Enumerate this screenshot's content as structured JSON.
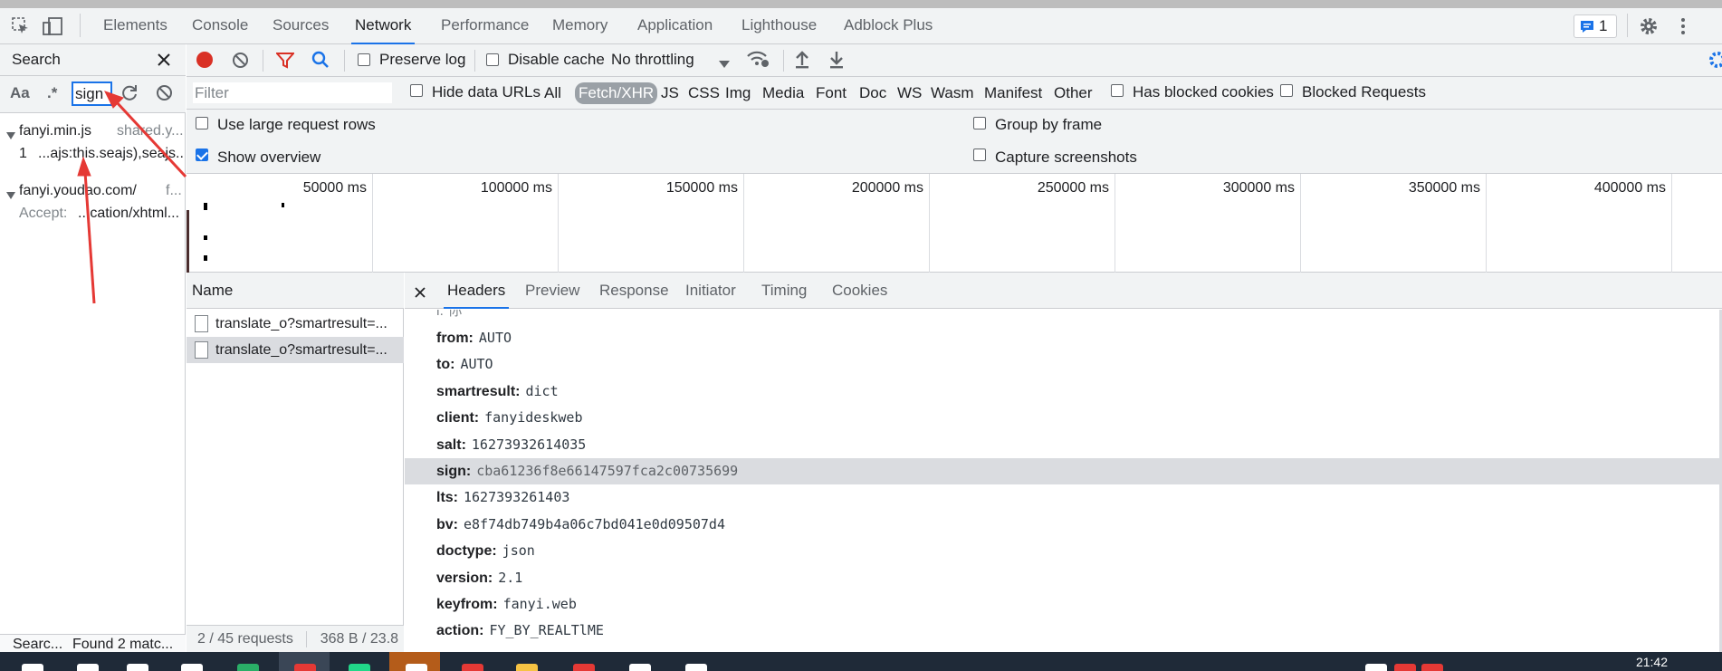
{
  "main_tabs": [
    "Elements",
    "Console",
    "Sources",
    "Network",
    "Performance",
    "Memory",
    "Application",
    "Lighthouse",
    "Adblock Plus"
  ],
  "active_tab": "Network",
  "issues_badge": "1",
  "search_pane": {
    "title": "Search",
    "case_toggle": "Aa",
    "regex_toggle": ".*",
    "query": "sign",
    "results": [
      {
        "file": "fanyi.min.js",
        "origin": "shared.y...",
        "line_no": "1",
        "snippet": "...ajs:this.seajs),seajs...."
      },
      {
        "file": "fanyi.youdao.com/",
        "origin": "f...",
        "line_label": "Accept:",
        "snippet": "...cation/xhtml..."
      }
    ],
    "status_left": "Searc...",
    "status_right": "Found 2 matc..."
  },
  "toolbar": {
    "preserve_log": "Preserve log",
    "disable_cache": "Disable cache",
    "throttling": "No throttling"
  },
  "filter_bar": {
    "placeholder": "Filter",
    "hide_data_urls": "Hide data URLs",
    "types": [
      "All",
      "Fetch/XHR",
      "JS",
      "CSS",
      "Img",
      "Media",
      "Font",
      "Doc",
      "WS",
      "Wasm",
      "Manifest",
      "Other"
    ],
    "active_type": "Fetch/XHR",
    "has_blocked_cookies": "Has blocked cookies",
    "blocked_requests": "Blocked Requests"
  },
  "settings": {
    "use_large_rows": "Use large request rows",
    "show_overview": "Show overview",
    "group_by_frame": "Group by frame",
    "capture_screenshots": "Capture screenshots"
  },
  "overview": {
    "ticks": [
      "50000 ms",
      "100000 ms",
      "150000 ms",
      "200000 ms",
      "250000 ms",
      "300000 ms",
      "350000 ms",
      "400000 ms"
    ]
  },
  "requests": {
    "header": "Name",
    "rows": [
      "translate_o?smartresult=...",
      "translate_o?smartresult=..."
    ],
    "footer_count": "2 / 45 requests",
    "footer_size": "368 B / 23.8"
  },
  "details": {
    "tabs": [
      "Headers",
      "Preview",
      "Response",
      "Initiator",
      "Timing",
      "Cookies"
    ],
    "active_tab": "Headers",
    "partial_top": "i: 你",
    "fields": [
      {
        "k": "from:",
        "v": "AUTO"
      },
      {
        "k": "to:",
        "v": "AUTO"
      },
      {
        "k": "smartresult:",
        "v": "dict"
      },
      {
        "k": "client:",
        "v": "fanyideskweb"
      },
      {
        "k": "salt:",
        "v": "16273932614035"
      },
      {
        "k": "sign:",
        "v": "cba61236f8e66147597fca2c00735699"
      },
      {
        "k": "lts:",
        "v": "1627393261403"
      },
      {
        "k": "bv:",
        "v": "e8f74db749b4a06c7bd041e0d09507d4"
      },
      {
        "k": "doctype:",
        "v": "json"
      },
      {
        "k": "version:",
        "v": "2.1"
      },
      {
        "k": "keyfrom:",
        "v": "fanyi.web"
      },
      {
        "k": "action:",
        "v": "FY_BY_REALTlME"
      }
    ]
  },
  "taskbar": {
    "clock": "21:42"
  },
  "colors": {
    "accent": "#1a73e8",
    "record": "#d93025",
    "annotation": "#e53935"
  }
}
